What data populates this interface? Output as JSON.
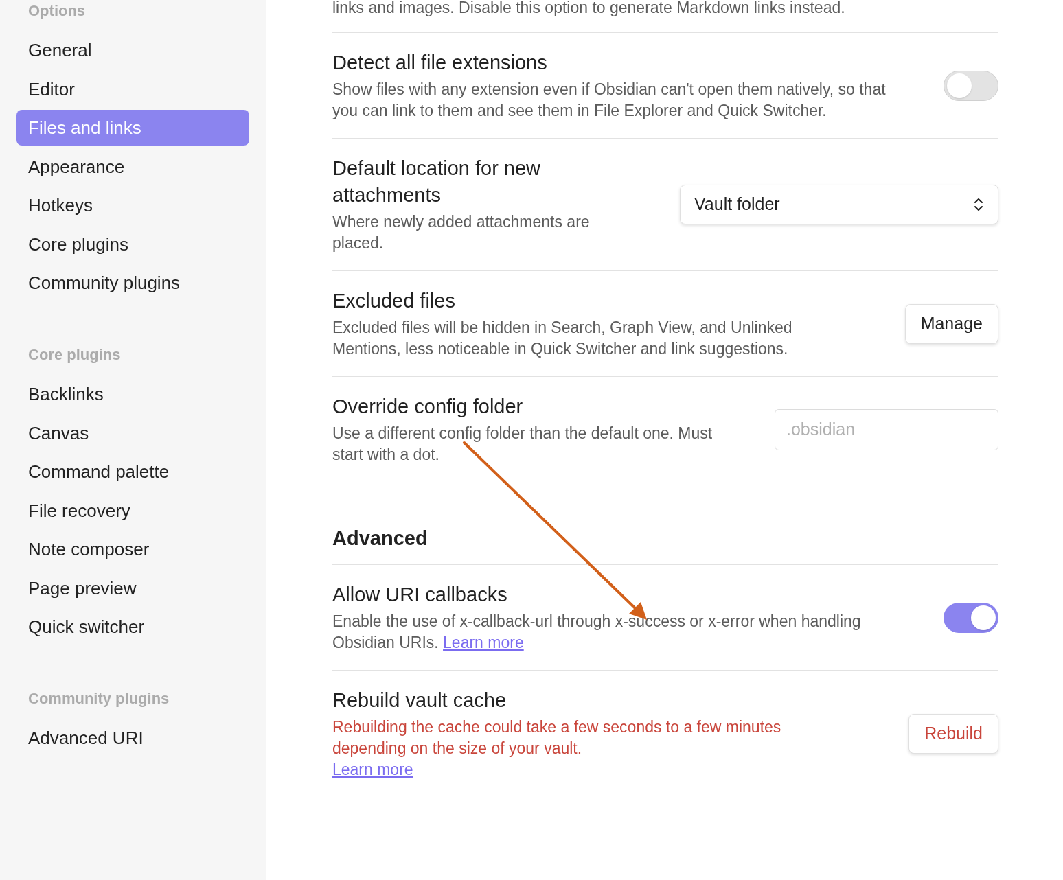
{
  "sidebar": {
    "groups": [
      {
        "heading": "Options",
        "items": [
          {
            "label": "General",
            "selected": false
          },
          {
            "label": "Editor",
            "selected": false
          },
          {
            "label": "Files and links",
            "selected": true
          },
          {
            "label": "Appearance",
            "selected": false
          },
          {
            "label": "Hotkeys",
            "selected": false
          },
          {
            "label": "Core plugins",
            "selected": false
          },
          {
            "label": "Community plugins",
            "selected": false
          }
        ]
      },
      {
        "heading": "Core plugins",
        "items": [
          {
            "label": "Backlinks",
            "selected": false
          },
          {
            "label": "Canvas",
            "selected": false
          },
          {
            "label": "Command palette",
            "selected": false
          },
          {
            "label": "File recovery",
            "selected": false
          },
          {
            "label": "Note composer",
            "selected": false
          },
          {
            "label": "Page preview",
            "selected": false
          },
          {
            "label": "Quick switcher",
            "selected": false
          }
        ]
      },
      {
        "heading": "Community plugins",
        "items": [
          {
            "label": "Advanced URI",
            "selected": false
          }
        ]
      }
    ]
  },
  "settings": [
    {
      "kind": "partial",
      "description": "links and images. Disable this option to generate Markdown links instead."
    },
    {
      "kind": "toggle",
      "title": "Detect all file extensions",
      "description": "Show files with any extension even if Obsidian can't open them natively, so that you can link to them and see them in File Explorer and Quick Switcher.",
      "on": false
    },
    {
      "kind": "dropdown",
      "title": "Default location for new attachments",
      "description": "Where newly added attachments are placed.",
      "value": "Vault folder"
    },
    {
      "kind": "button",
      "title": "Excluded files",
      "description": "Excluded files will be hidden in Search, Graph View, and Unlinked Mentions, less noticeable in Quick Switcher and link suggestions.",
      "button": "Manage",
      "warning": false
    },
    {
      "kind": "input",
      "title": "Override config folder",
      "description": "Use a different config folder than the default one. Must start with a dot.",
      "placeholder": ".obsidian"
    },
    {
      "kind": "heading",
      "title": "Advanced"
    },
    {
      "kind": "toggle",
      "title": "Allow URI callbacks",
      "description": "Enable the use of x-callback-url through x-success or x-error when handling Obsidian URIs.",
      "link": "Learn more",
      "on": true
    },
    {
      "kind": "button",
      "title": "Rebuild vault cache",
      "description": "Rebuilding the cache could take a few seconds to a few minutes depending on the size of your vault.",
      "link": "Learn more",
      "link_break": true,
      "button": "Rebuild",
      "warning": true
    }
  ]
}
